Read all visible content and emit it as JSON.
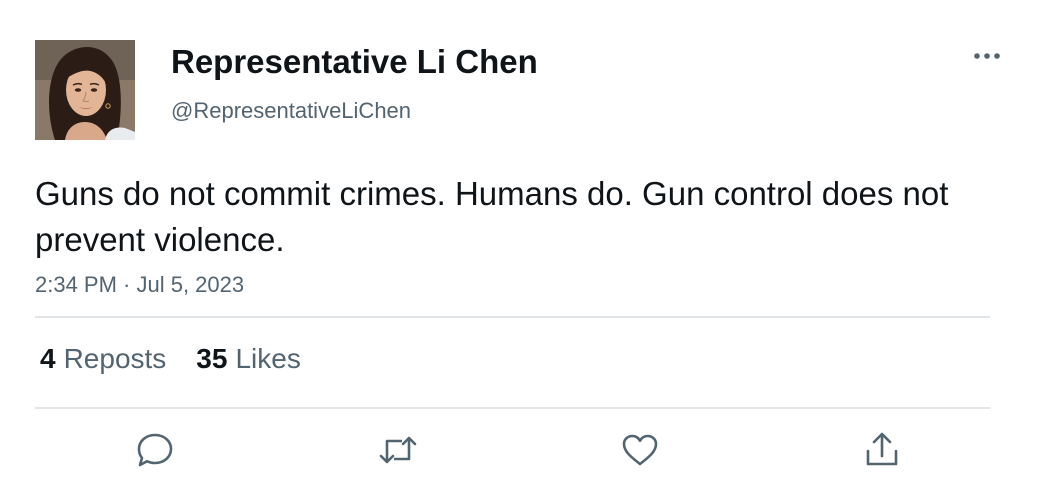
{
  "author": {
    "display_name": "Representative Li Chen",
    "handle": "@RepresentativeLiChen",
    "avatar_icon": "profile-photo"
  },
  "more_icon": "ellipsis-icon",
  "tweet": {
    "text": "Guns do not commit crimes. Humans do. Gun control does not prevent violence.",
    "timestamp": "2:34 PM · Jul 5, 2023"
  },
  "stats": {
    "reposts_count": "4",
    "reposts_label": "Reposts",
    "likes_count": "35",
    "likes_label": "Likes"
  },
  "actions": {
    "reply_icon": "reply-icon",
    "repost_icon": "repost-icon",
    "like_icon": "like-icon",
    "share_icon": "share-icon"
  },
  "colors": {
    "text_primary": "#0f1419",
    "text_secondary": "#536471",
    "divider": "#e1e5e8"
  }
}
